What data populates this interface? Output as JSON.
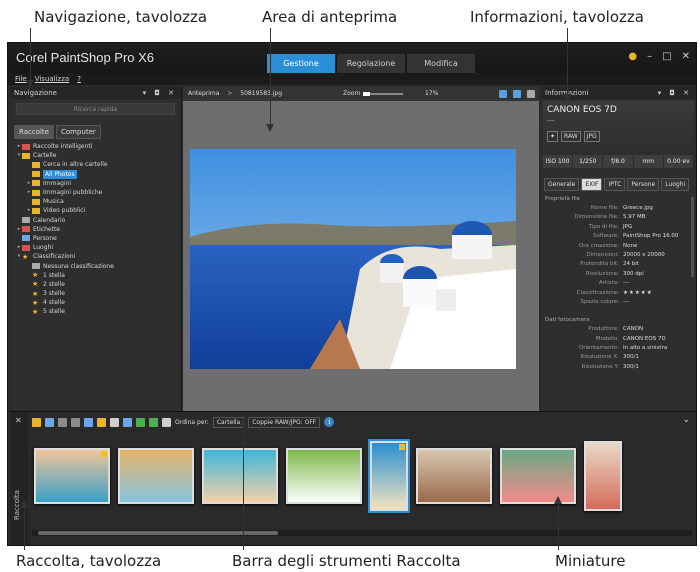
{
  "callouts": {
    "nav_palette": "Navigazione, tavolozza",
    "preview_area": "Area di anteprima",
    "info_palette": "Informazioni, tavolozza",
    "organizer_palette": "Raccolta, tavolozza",
    "organizer_toolbar": "Barra degli strumenti Raccolta",
    "thumbnails": "Miniature"
  },
  "app": {
    "title": "Corel PaintShop Pro X6",
    "workspace_tabs": [
      {
        "label": "Gestione",
        "active": true
      },
      {
        "label": "Regolazione",
        "active": false
      },
      {
        "label": "Modifica",
        "active": false
      }
    ],
    "menu": [
      "File",
      "Visualizza",
      "?"
    ]
  },
  "navigation": {
    "title": "Navigazione",
    "search_placeholder": "Ricerca rapida",
    "tabs": [
      {
        "label": "Raccolte",
        "active": true
      },
      {
        "label": "Computer",
        "active": false
      }
    ],
    "tree": [
      {
        "label": "Raccolte intelligenti",
        "icon": "smart-collection-icon",
        "toggle": "▸",
        "selected": false
      },
      {
        "label": "Cartelle",
        "icon": "folder-icon",
        "toggle": "▾",
        "selected": false
      },
      {
        "label": "Cerca in altre cartelle",
        "icon": "folder-search-icon",
        "toggle": "",
        "selected": false
      },
      {
        "label": "All Photos",
        "icon": "folder-icon",
        "toggle": "",
        "selected": true
      },
      {
        "label": "Immagini",
        "icon": "folder-icon",
        "toggle": "▸",
        "selected": false
      },
      {
        "label": "Immagini pubbliche",
        "icon": "folder-icon",
        "toggle": "▸",
        "selected": false
      },
      {
        "label": "Musica",
        "icon": "folder-icon",
        "toggle": "",
        "selected": false
      },
      {
        "label": "Video pubblici",
        "icon": "folder-icon",
        "toggle": "▸",
        "selected": false
      },
      {
        "label": "Calendario",
        "icon": "calendar-icon",
        "toggle": "",
        "selected": false
      },
      {
        "label": "Etichette",
        "icon": "tag-icon",
        "toggle": "▸",
        "selected": false
      },
      {
        "label": "Persone",
        "icon": "people-icon",
        "toggle": "",
        "selected": false
      },
      {
        "label": "Luoghi",
        "icon": "pin-icon",
        "toggle": "▸",
        "selected": false
      },
      {
        "label": "Classificazioni",
        "icon": "star-icon",
        "toggle": "▾",
        "selected": false
      },
      {
        "label": "Nessuna classificazione",
        "icon": "no-rating-icon",
        "toggle": "",
        "selected": false
      },
      {
        "label": "1 stella",
        "icon": "star-icon",
        "toggle": "",
        "selected": false
      },
      {
        "label": "2 stelle",
        "icon": "star-icon",
        "toggle": "",
        "selected": false
      },
      {
        "label": "3 stelle",
        "icon": "star-icon",
        "toggle": "",
        "selected": false
      },
      {
        "label": "4 stelle",
        "icon": "star-icon",
        "toggle": "",
        "selected": false
      },
      {
        "label": "5 stelle",
        "icon": "star-icon",
        "toggle": "",
        "selected": false
      }
    ]
  },
  "preview": {
    "title": "Anteprima",
    "separator": ">",
    "filename": "50819583.jpg",
    "zoom_label": "Zoom",
    "zoom_value": "17%",
    "zoom_fraction": 0.17
  },
  "info": {
    "title": "Informazioni",
    "camera": "CANON EOS 7D",
    "dash": "---",
    "badges": [
      "RAW",
      "JPG"
    ],
    "exposure": [
      "ISO 100",
      "1/250",
      "f/8.0",
      "mm",
      "0.00 ev"
    ],
    "tabs": [
      {
        "label": "Generale",
        "active": false
      },
      {
        "label": "EXIF",
        "active": true
      },
      {
        "label": "IPTC",
        "active": false
      },
      {
        "label": "Persone",
        "active": false
      },
      {
        "label": "Luoghi",
        "active": false
      }
    ],
    "file_section": "Proprietà file",
    "file_props": [
      {
        "k": "Nome file:",
        "v": "Greece.jpg"
      },
      {
        "k": "Dimensione file:",
        "v": "5.97 MB"
      },
      {
        "k": "Tipo di file:",
        "v": "JPG"
      },
      {
        "k": "Software:",
        "v": "PaintShop Pro 16.00"
      },
      {
        "k": "Ora creazione:",
        "v": "None"
      },
      {
        "k": "Dimensioni:",
        "v": "20000 x 20000"
      },
      {
        "k": "Profondità bit:",
        "v": "24 bit"
      },
      {
        "k": "Risoluzione:",
        "v": "300 dpi"
      },
      {
        "k": "Artista:",
        "v": "---"
      },
      {
        "k": "Classificazione:",
        "v": "★★★★★"
      },
      {
        "k": "Spazio colore:",
        "v": "---"
      }
    ],
    "camera_section": "Dati fotocamera",
    "camera_props": [
      {
        "k": "Produttore:",
        "v": "CANON"
      },
      {
        "k": "Modello:",
        "v": "CANON EOS 7D"
      },
      {
        "k": "Orientamento:",
        "v": "In alto a sinistra"
      },
      {
        "k": "Risoluzione X:",
        "v": "300/1"
      },
      {
        "k": "Risoluzione Y:",
        "v": "300/1"
      }
    ]
  },
  "organizer": {
    "side_label": "Raccolta",
    "sort_label": "Ordina per:",
    "sort_value": "Cartella",
    "raw_pairs": "Coppie RAW/JPG: OFF",
    "info_button": "i",
    "thumbnails": [
      {
        "name": "family-beach",
        "colors": [
          "#f2c59a",
          "#3aa0c8"
        ],
        "portrait": false,
        "selected": false,
        "badge": true
      },
      {
        "name": "couple-beach",
        "colors": [
          "#e6b46b",
          "#87c2df"
        ],
        "portrait": false,
        "selected": false,
        "badge": false
      },
      {
        "name": "child-pool",
        "colors": [
          "#3fb6d9",
          "#f4d0a8"
        ],
        "portrait": false,
        "selected": false,
        "badge": false
      },
      {
        "name": "boy-field",
        "colors": [
          "#7db84a",
          "#ffffff"
        ],
        "portrait": false,
        "selected": false,
        "badge": false
      },
      {
        "name": "diver-portrait",
        "colors": [
          "#2b8fd0",
          "#f2e3c0"
        ],
        "portrait": true,
        "selected": true,
        "badge": true
      },
      {
        "name": "family-portrait",
        "colors": [
          "#d9c6b0",
          "#9a6a4a"
        ],
        "portrait": false,
        "selected": false,
        "badge": false
      },
      {
        "name": "flamingos",
        "colors": [
          "#6aa883",
          "#f38b8b"
        ],
        "portrait": false,
        "selected": false,
        "badge": false
      },
      {
        "name": "girl-portrait",
        "colors": [
          "#e9d8c6",
          "#d56b5b"
        ],
        "portrait": true,
        "selected": false,
        "badge": false
      }
    ]
  }
}
